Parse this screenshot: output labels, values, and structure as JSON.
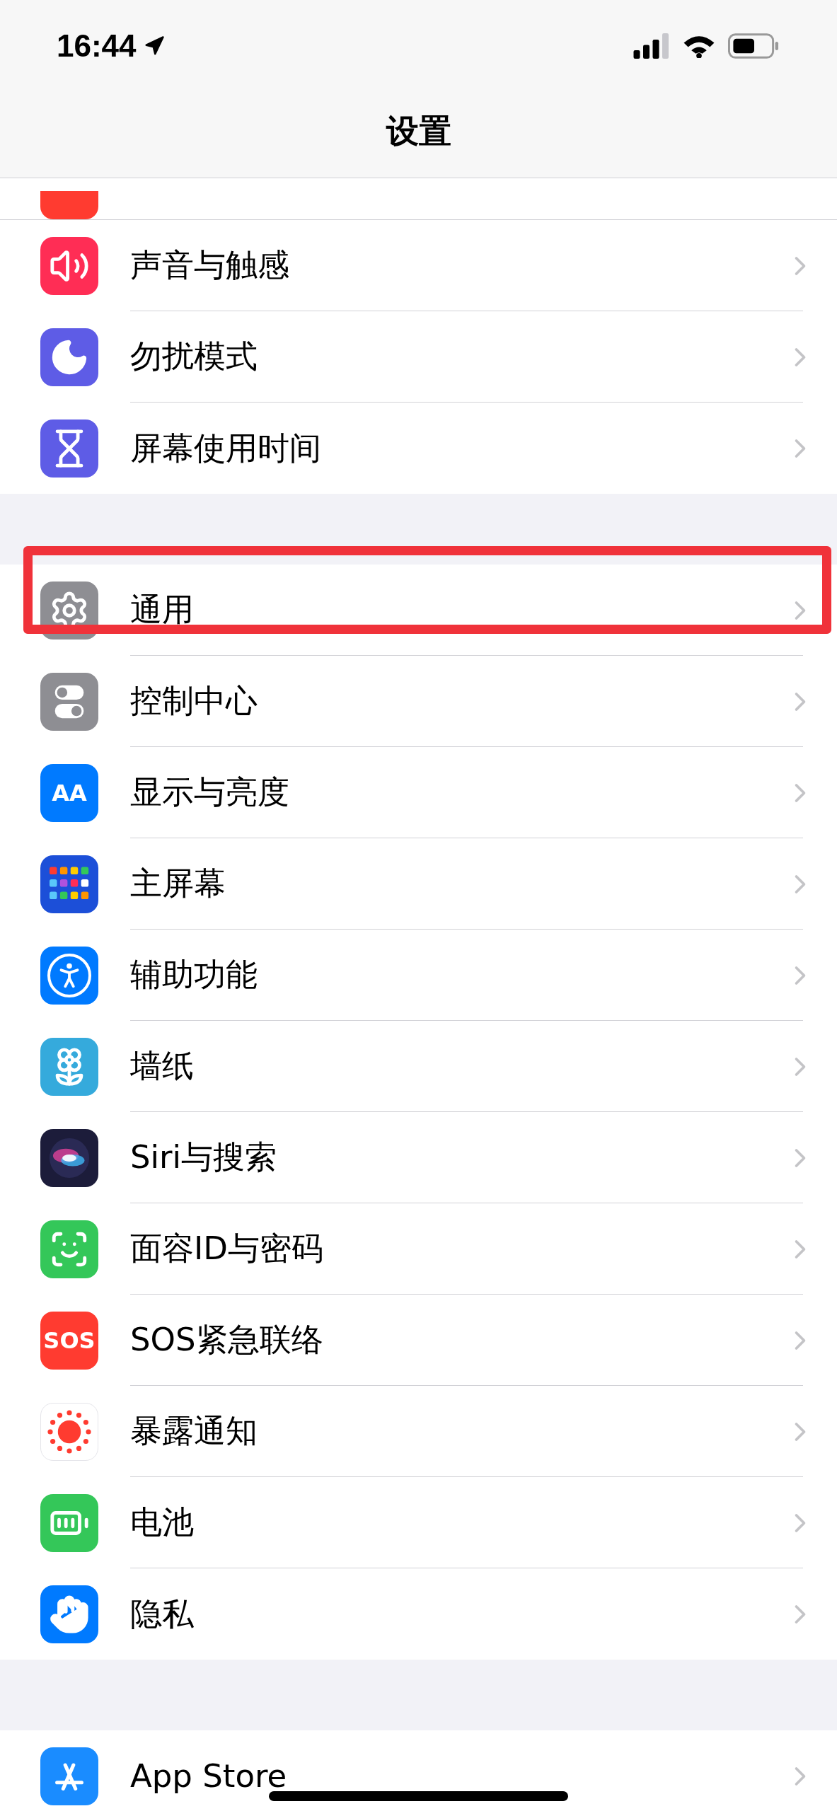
{
  "status_bar": {
    "time": "16:44"
  },
  "nav": {
    "title": "设置"
  },
  "partial_row": {
    "color": "#ff3b30"
  },
  "groups": [
    {
      "rows": [
        {
          "label": "声音与触感",
          "kind": "sound",
          "color": "#ff2d55",
          "annotated": false
        },
        {
          "label": "勿扰模式",
          "kind": "moon",
          "color": "#5e5ce6",
          "annotated": false
        },
        {
          "label": "屏幕使用时间",
          "kind": "hourglass",
          "color": "#5e5ce6",
          "annotated": false
        }
      ]
    },
    {
      "rows": [
        {
          "label": "通用",
          "kind": "gear",
          "color": "#8e8e93",
          "annotated": true
        },
        {
          "label": "控制中心",
          "kind": "toggles",
          "color": "#8e8e93",
          "annotated": false
        },
        {
          "label": "显示与亮度",
          "kind": "text",
          "icon_text": "AA",
          "color": "#007aff",
          "annotated": false
        },
        {
          "label": "主屏幕",
          "kind": "grid",
          "color": "#1c4fd8",
          "annotated": false
        },
        {
          "label": "辅助功能",
          "kind": "person",
          "color": "#007aff",
          "annotated": false
        },
        {
          "label": "墙纸",
          "kind": "flower",
          "color": "#35aadc",
          "annotated": false
        },
        {
          "label": "Siri与搜索",
          "kind": "siri",
          "color": "#1c1c3a",
          "annotated": false
        },
        {
          "label": "面容ID与密码",
          "kind": "face",
          "color": "#34c759",
          "annotated": false
        },
        {
          "label": "SOS紧急联络",
          "kind": "text",
          "icon_text": "SOS",
          "color": "#ff3b30",
          "annotated": false
        },
        {
          "label": "暴露通知",
          "kind": "exposure",
          "color": "#ffffff",
          "annotated": false
        },
        {
          "label": "电池",
          "kind": "battery",
          "color": "#34c759",
          "annotated": false
        },
        {
          "label": "隐私",
          "kind": "hand",
          "color": "#007aff",
          "annotated": false
        }
      ]
    },
    {
      "rows": [
        {
          "label": "App Store",
          "kind": "appstore",
          "color": "#1a8cff",
          "annotated": false
        }
      ]
    }
  ]
}
